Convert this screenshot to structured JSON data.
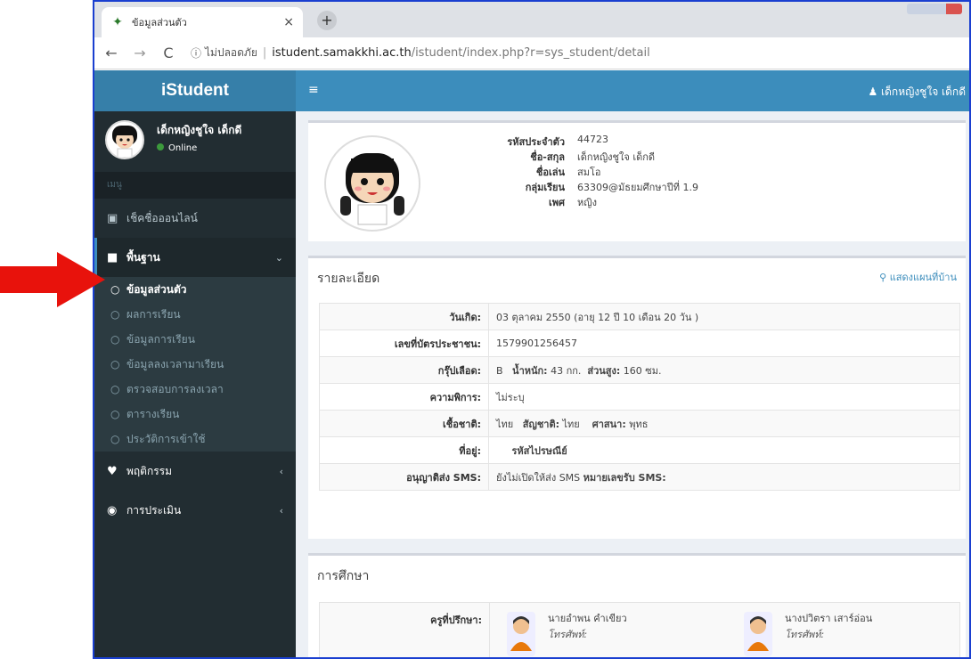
{
  "browser": {
    "tab_title": "ข้อมูลส่วนตัว",
    "tab_close": "×",
    "new_tab": "+",
    "security_text": "ไม่ปลอดภัย",
    "url_host": "istudent.samakkhi.ac.th",
    "url_path": "/istudent/index.php?r=sys_student/detail"
  },
  "brand": {
    "name": "iStudent"
  },
  "topbar": {
    "user_name": "เด็กหญิงชูใจ เด็กดี"
  },
  "sidebar": {
    "user_name": "เด็กหญิงชูใจ เด็กดี",
    "user_status": "Online",
    "menu_header": "เมนู",
    "checkin": "เช็คชื่อออนไลน์",
    "basic": "พื้นฐาน",
    "sub_items": [
      "ข้อมูลส่วนตัว",
      "ผลการเรียน",
      "ข้อมูลการเรียน",
      "ข้อมูลลงเวลามาเรียน",
      "ตรวจสอบการลงเวลา",
      "ตารางเรียน",
      "ประวัติการเข้าใช้"
    ],
    "behavior": "พฤติกรรม",
    "evaluation": "การประเมิน"
  },
  "profile": {
    "labels": [
      "รหัสประจำตัว",
      "ชื่อ-สกุล",
      "ชื่อเล่น",
      "กลุ่มเรียน",
      "เพศ"
    ],
    "values": [
      "44723",
      "เด็กหญิงชูใจ เด็กดี",
      "สมโอ",
      "63309@มัธยมศึกษาปีที่ 1.9",
      "หญิง"
    ]
  },
  "details": {
    "title": "รายละเอียด",
    "map_link": "แสดงแผนที่บ้าน",
    "birth_label": "วันเกิด:",
    "birth_value": "03 ตุลาคม 2550  (อายุ 12 ปี 10 เดือน 20 วัน )",
    "idcard_label": "เลขที่บัตรประชาชน:",
    "idcard_value": "1579901256457",
    "blood_label": "กรุ๊ปเลือด:",
    "blood_value": "B",
    "weight_label": "น้ำหนัก:",
    "weight_value": "43 กก.",
    "height_label": "ส่วนสูง:",
    "height_value": "160 ซม.",
    "disability_label": "ความพิการ:",
    "disability_value": "ไม่ระบุ",
    "race_label": "เชื้อชาติ:",
    "race_value": "ไทย",
    "nationality_label": "สัญชาติ:",
    "nationality_value": "ไทย",
    "religion_label": "ศาสนา:",
    "religion_value": "พุทธ",
    "address_label": "ที่อยู่:",
    "postcode_label": "รหัสไปรษณีย์",
    "sms_label": "อนุญาติส่ง SMS:",
    "sms_value": "ยังไม่เปิดให้ส่ง SMS",
    "sms_number_label": "หมายเลขรับ SMS:"
  },
  "education": {
    "title": "การศึกษา",
    "advisor_label": "ครูที่ปรึกษา:",
    "advisors": [
      {
        "name": "นายอำพน คำเขียว",
        "phone": "โทรศัพท์:"
      },
      {
        "name": "นางปวิตรา เสาร์อ่อน",
        "phone": "โทรศัพท์:"
      }
    ]
  },
  "colors": {
    "sidebar": "#222d32",
    "header": "#3c8dbc",
    "brand": "#367fa9",
    "arrow": "#e8120c"
  }
}
